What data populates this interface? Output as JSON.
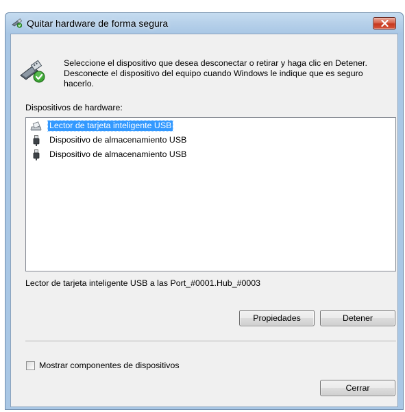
{
  "window": {
    "title": "Quitar hardware de forma segura"
  },
  "instruction": "Seleccione el dispositivo que desea desconectar o retirar y haga clic en Detener. Desconecte el dispositivo del equipo cuando Windows le indique que es seguro hacerlo.",
  "devices_label": "Dispositivos de hardware:",
  "devices": [
    {
      "label": "Lector de tarjeta inteligente USB",
      "icon": "smart-card-reader-icon",
      "selected": true
    },
    {
      "label": "Dispositivo de almacenamiento USB",
      "icon": "usb-plug-icon",
      "selected": false
    },
    {
      "label": "Dispositivo de almacenamiento USB",
      "icon": "usb-plug-icon",
      "selected": false
    }
  ],
  "device_location": "Lector de tarjeta inteligente USB a las Port_#0001.Hub_#0003",
  "buttons": {
    "properties": "Propiedades",
    "stop": "Detener",
    "close": "Cerrar"
  },
  "checkbox": {
    "label": "Mostrar componentes de dispositivos",
    "checked": false
  },
  "colors": {
    "selection": "#3399ff",
    "title_gradient": "#b7d1ea",
    "close_button": "#c6381e",
    "dialog_bg": "#f0f0f0"
  }
}
